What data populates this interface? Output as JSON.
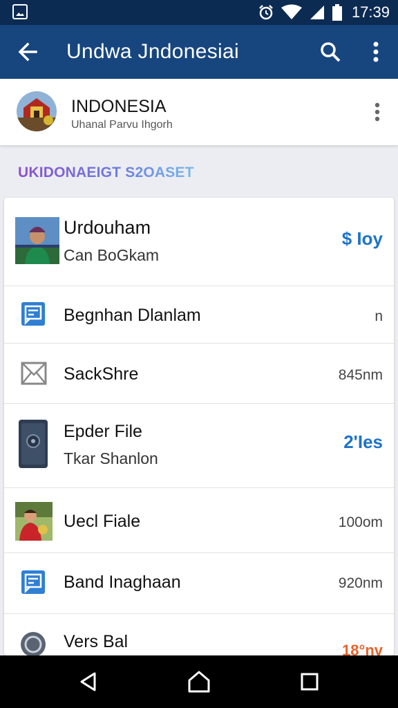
{
  "status_bar": {
    "time": "17:39",
    "icons": [
      "gallery-icon",
      "alarm-icon",
      "wifi-icon",
      "signal-icon",
      "battery-icon"
    ]
  },
  "app_bar": {
    "title": "Undwa Jndonesiai",
    "icons": [
      "back-arrow-icon",
      "search-icon",
      "more-vert-icon"
    ]
  },
  "profile": {
    "name": "INDONESIA",
    "subtitle": "Uhanal Parvu Ihgorh"
  },
  "section_header": "UKIDONAEIGT S2OASET",
  "list": [
    {
      "primary": "Urdouham",
      "secondary": "Can BoGkam",
      "trailing": "$ Ioy",
      "thumb": "person-photo"
    },
    {
      "primary": "Begnhan Dlanlam",
      "secondary": "",
      "trailing": "n",
      "thumb": "blue-document-icon"
    },
    {
      "primary": "SackShre",
      "secondary": "",
      "trailing": "845nm",
      "thumb": "envelope-icon"
    },
    {
      "primary": "Epder File",
      "secondary": "Tkar Shanlon",
      "trailing": "2'Ies",
      "thumb": "phone-device-icon"
    },
    {
      "primary": "Uecl Fiale",
      "secondary": "",
      "trailing": "100om",
      "thumb": "person-photo-red"
    },
    {
      "primary": "Band Inaghaan",
      "secondary": "",
      "trailing": "920nm",
      "thumb": "blue-document-icon"
    },
    {
      "primary": "Vers Bal",
      "secondary": "",
      "trailing": "18°nv",
      "thumb": "circle-grey-icon"
    }
  ],
  "nav_bar": {
    "icons": [
      "nav-back-icon",
      "nav-home-icon",
      "nav-recents-icon"
    ]
  },
  "colors": {
    "status_bar": "#0c2b53",
    "app_bar": "#17467f",
    "accent_blue": "#1e73c8",
    "accent_orange": "#e8622a"
  }
}
